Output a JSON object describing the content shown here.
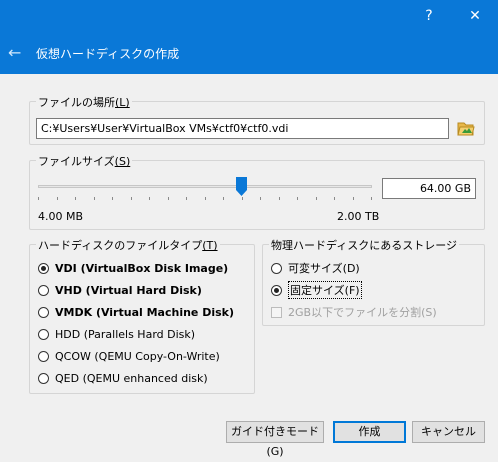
{
  "window": {
    "help_button": "?",
    "close_button": "✕"
  },
  "header": {
    "back_glyph": "←",
    "title": "仮想ハードディスクの作成"
  },
  "file_location": {
    "legend_text": "ファイルの場所",
    "legend_key": "(L)",
    "path_value": "C:¥Users¥User¥VirtualBox VMs¥ctf0¥ctf0.vdi",
    "browse_icon": "folder-open-icon"
  },
  "file_size": {
    "legend_text": "ファイルサイズ",
    "legend_key": "(S)",
    "value": "64.00 GB",
    "min_label": "4.00 MB",
    "max_label": "2.00 TB",
    "slider_fraction": 0.61
  },
  "disk_type": {
    "legend_text": "ハードディスクのファイルタイプ",
    "legend_key": "(T)",
    "options": [
      {
        "label": "VDI (VirtualBox Disk Image)",
        "selected": true,
        "bold": true
      },
      {
        "label": "VHD (Virtual Hard Disk)",
        "selected": false,
        "bold": true
      },
      {
        "label": "VMDK (Virtual Machine Disk)",
        "selected": false,
        "bold": true
      },
      {
        "label": "HDD (Parallels Hard Disk)",
        "selected": false,
        "bold": false
      },
      {
        "label": "QCOW (QEMU Copy-On-Write)",
        "selected": false,
        "bold": false
      },
      {
        "label": "QED (QEMU enhanced disk)",
        "selected": false,
        "bold": false
      }
    ]
  },
  "storage": {
    "legend_text": "物理ハードディスクにあるストレージ",
    "dynamic_label": "可変サイズ(D)",
    "fixed_label": "固定サイズ(F)",
    "split_label": "2GB以下でファイルを分割(S)"
  },
  "buttons": {
    "guided": "ガイド付きモード(G)",
    "create": "作成",
    "cancel": "キャンセル"
  },
  "colors": {
    "accent": "#0a78d7",
    "slider_thumb": "#0a78d7"
  }
}
